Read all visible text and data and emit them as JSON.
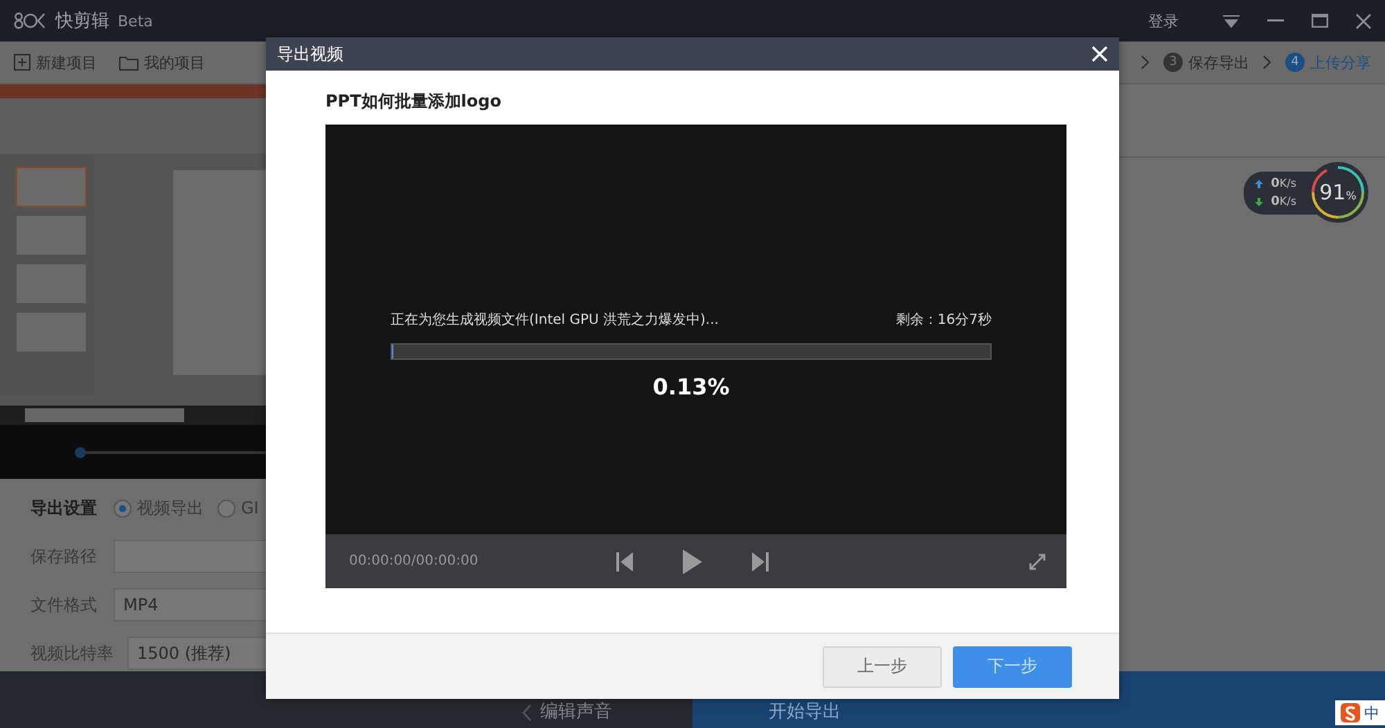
{
  "app": {
    "title": "快剪辑",
    "badge": "Beta",
    "login": "登录"
  },
  "toolbar": {
    "new_project": "新建项目",
    "my_projects": "我的项目",
    "steps": [
      {
        "number": "3",
        "label": "保存导出",
        "selected": false
      },
      {
        "number": "4",
        "label": "上传分享",
        "selected": true
      }
    ]
  },
  "export_settings": {
    "title": "导出设置",
    "modes": [
      {
        "label": "视频导出",
        "selected": true
      },
      {
        "label": "GI",
        "selected": false
      }
    ],
    "fields": [
      {
        "label": "保存路径",
        "kind": "path"
      },
      {
        "label": "文件格式",
        "kind": "select",
        "value": "MP4"
      },
      {
        "label": "视频比特率",
        "kind": "select",
        "value": "1500 (推荐)"
      }
    ]
  },
  "bottom_bar": {
    "back": "编辑声音",
    "start": "开始导出"
  },
  "network": {
    "upload": "0",
    "upload_unit": "K/s",
    "download": "0",
    "download_unit": "K/s",
    "memory": "91",
    "memory_unit": "%"
  },
  "dialog": {
    "title": "导出视频",
    "video_title": "PPT如何批量添加logo",
    "status": "正在为您生成视频文件(Intel GPU 洪荒之力爆发中)...",
    "remaining": "剩余：16分7秒",
    "progress": {
      "level": 0.0013,
      "reading": "0.13%"
    },
    "time": "00:00:00/00:00:00",
    "buttons": [
      {
        "label": "上一步",
        "kind": "secondary"
      },
      {
        "label": "下一步",
        "kind": "primary"
      }
    ]
  },
  "ime": {
    "label": "中"
  }
}
